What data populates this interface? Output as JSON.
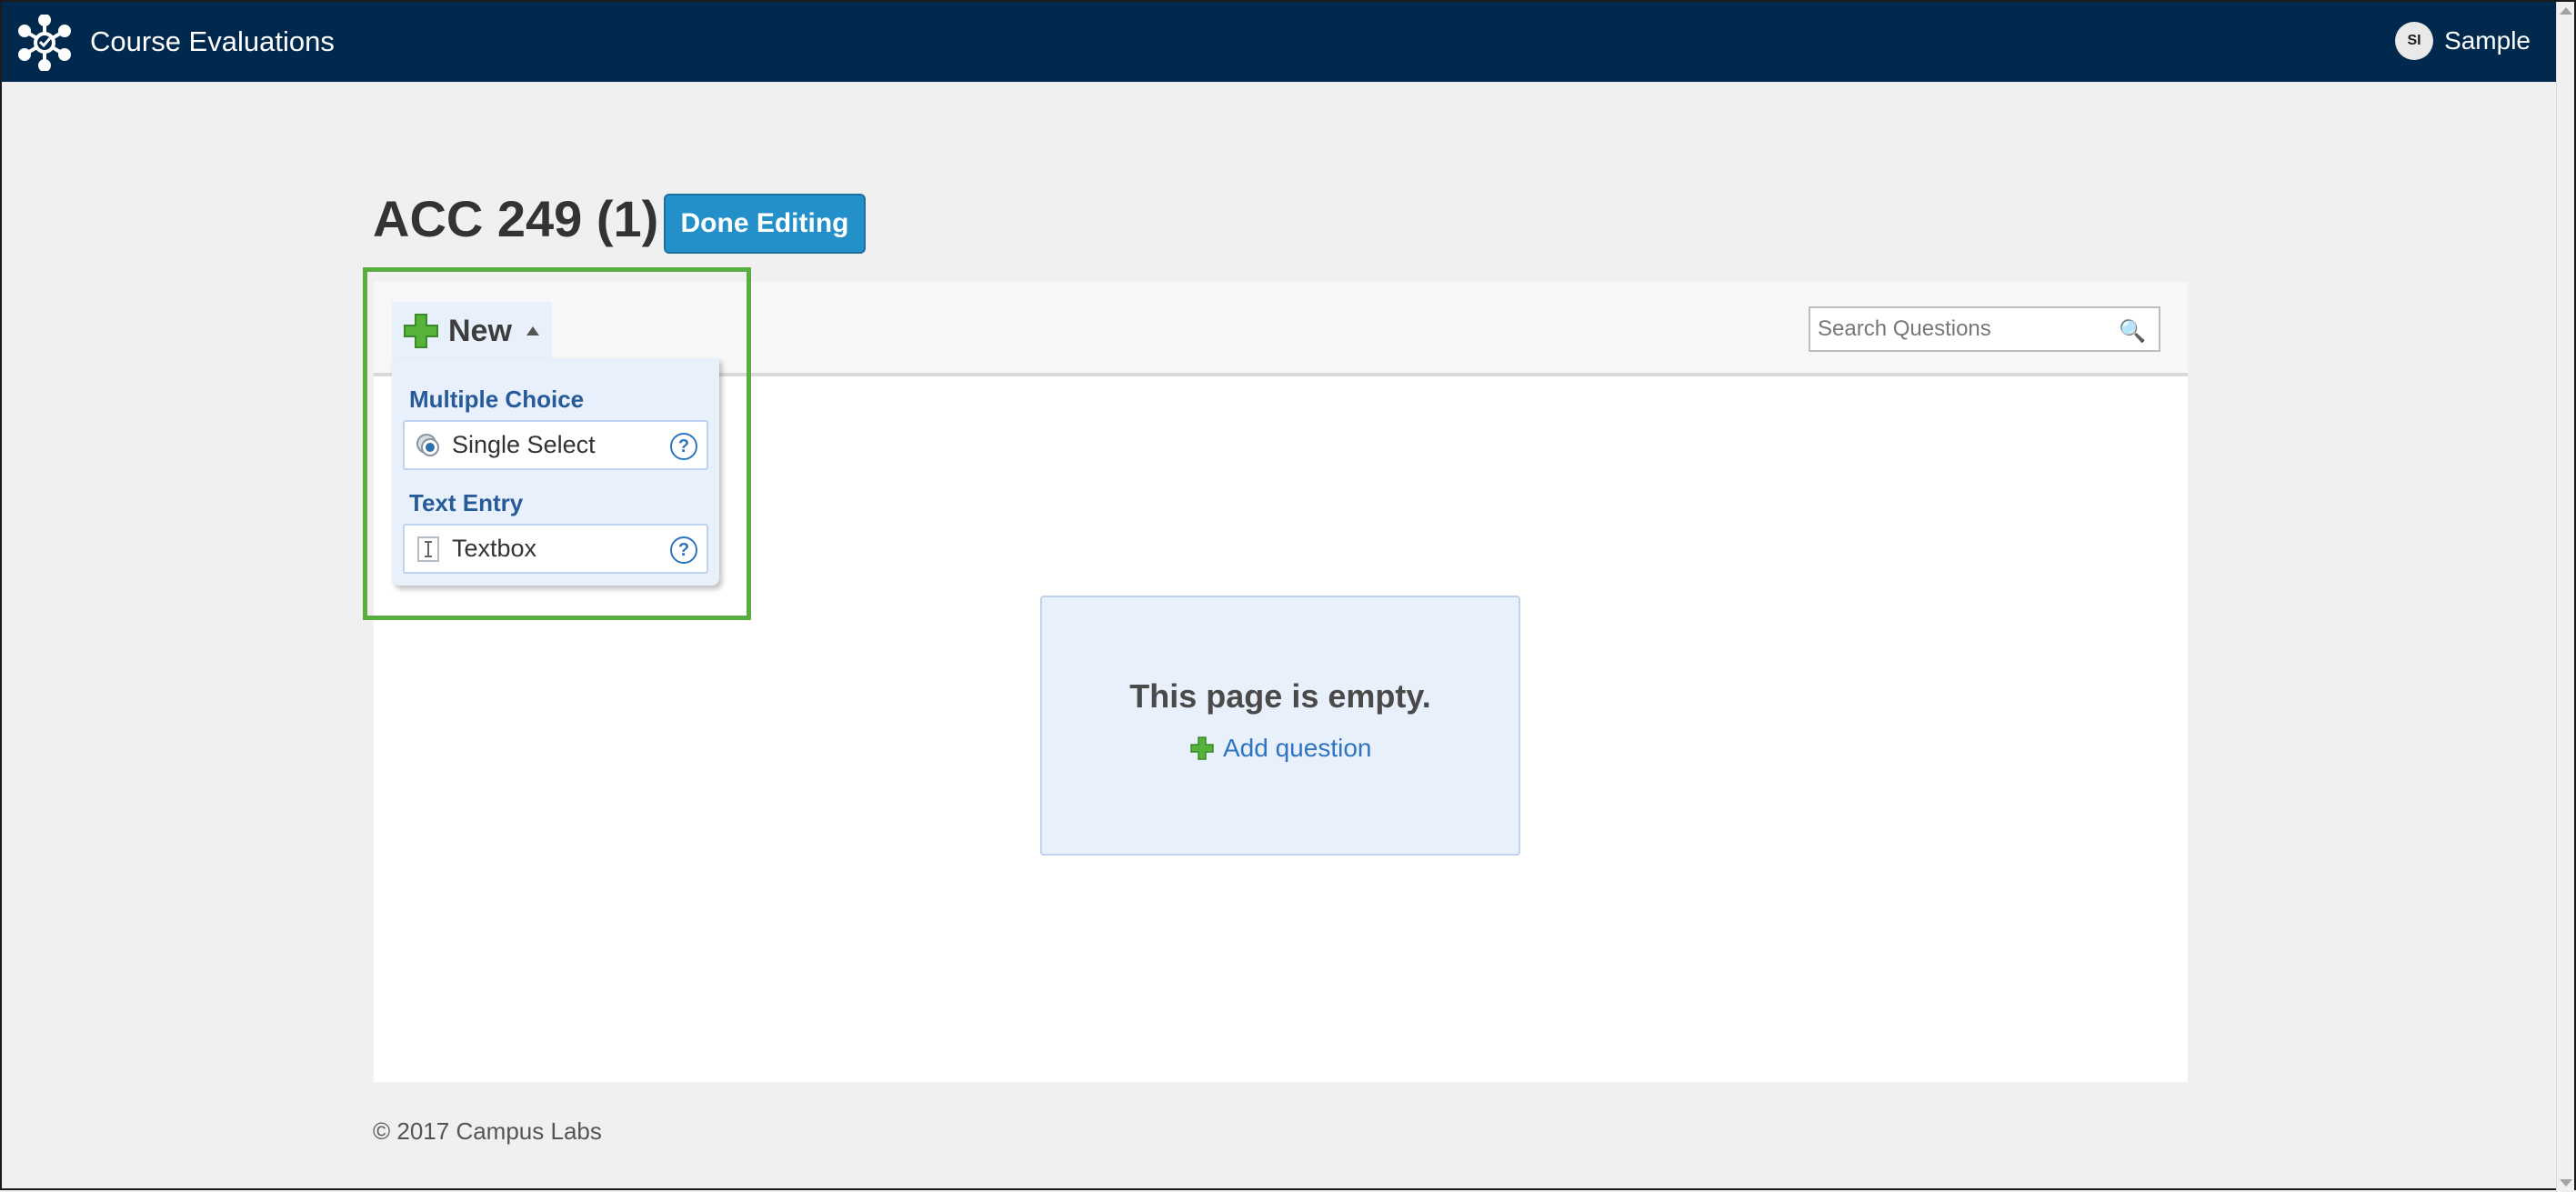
{
  "app": {
    "title": "Course Evaluations",
    "user_initials": "SI",
    "user_name": "Sample"
  },
  "page": {
    "title": "ACC 249 (1)",
    "done_button": "Done Editing"
  },
  "toolbar": {
    "new_label": "New",
    "search_placeholder": "Search Questions"
  },
  "new_menu": {
    "groups": [
      {
        "heading": "Multiple Choice",
        "item": "Single Select",
        "icon": "radio-icon"
      },
      {
        "heading": "Text Entry",
        "item": "Textbox",
        "icon": "text-cursor-icon"
      }
    ],
    "help_glyph": "?"
  },
  "empty_state": {
    "title": "This page is empty.",
    "add_question": "Add question"
  },
  "footer": {
    "copyright": "© 2017 Campus Labs"
  },
  "colors": {
    "header_bg": "#00294d",
    "accent_button": "#2490c9",
    "highlight_border": "#5aad41",
    "link": "#2f74c0",
    "menu_bg": "#e8f0fb"
  }
}
